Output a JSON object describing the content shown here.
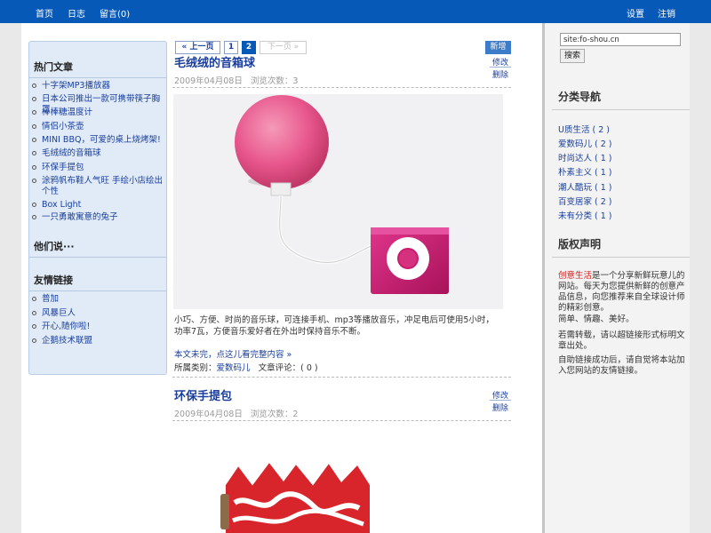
{
  "topnav": {
    "left": [
      "首页",
      "日志",
      "留言(0)"
    ],
    "right": [
      "设置",
      "注销"
    ]
  },
  "left_sidebar": {
    "hot_title": "热门文章",
    "hot_items": [
      "十字架MP3播放器",
      "日本公司推出一款可携带筷子胸罩",
      "棒棒糖温度计",
      "情侣小茶壶",
      "MINI BBQ，可爱的桌上烧烤架!",
      "毛绒绒的音箱球",
      "环保手提包",
      "涂鸦帆布鞋人气旺 手绘小店绘出个性",
      "Box Light",
      "一只勇敢寓意的兔子"
    ],
    "they_say_title": "他们说···",
    "links_title": "友情链接",
    "links": [
      "普加",
      "风暴巨人",
      "开心,随你啦!",
      "企鹅技术联盟"
    ]
  },
  "pager": {
    "prev": "« 上一页",
    "pages": [
      "1",
      "2"
    ],
    "current": "2",
    "next": "下一页 »"
  },
  "actions": {
    "new": "新增",
    "edit": "修改",
    "delete": "删除"
  },
  "posts": [
    {
      "title": "毛绒绒的音箱球",
      "date": "2009年04月08日",
      "views": "浏览次数：3",
      "text": "小巧、方便、时尚的音乐球，可连接手机、mp3等播放音乐，冲足电后可使用5小时，功率7瓦，方便音乐爱好者在外出时保持音乐不断。",
      "more": "本文未完，点这儿看完整内容 »",
      "category_label": "所属类别：",
      "category": "爱数码儿",
      "comments": "文章评论：( 0 )"
    },
    {
      "title": "环保手提包",
      "date": "2009年04月08日",
      "views": "浏览次数：2"
    }
  ],
  "right_sidebar": {
    "search_value": "site:fo-shou.cn",
    "search_button": "搜索",
    "cat_title": "分类导航",
    "categories": [
      "U质生活 ( 2 )",
      "爱数码儿 ( 2 )",
      "时尚达人 ( 1 )",
      "朴素主义 ( 1 )",
      "潮人酷玩 ( 1 )",
      "百变居家 ( 2 )",
      "未有分类 ( 1 )"
    ],
    "copyright_title": "版权声明",
    "copyright_brand": "创意生活",
    "copyright_p1": "是一个分享新鲜玩意儿的网站。每天为您提供新鲜的创意产品信息，向您推荐来自全球设计师的精彩创意。",
    "copyright_p2": "简单、情趣、美好。",
    "copyright_p3": "若需转载，请以超链接形式标明文章出处。",
    "copyright_p4": "自助链接成功后，请自觉将本站加入您网站的友情链接。"
  },
  "colors": {
    "topbar": "#0759b8",
    "link": "#1a3e9a",
    "sidebar_bg": "#e0ebf7",
    "speaker_pink": "#e8578d",
    "player_magenta": "#c91a6e",
    "bag_red": "#d8252b"
  }
}
